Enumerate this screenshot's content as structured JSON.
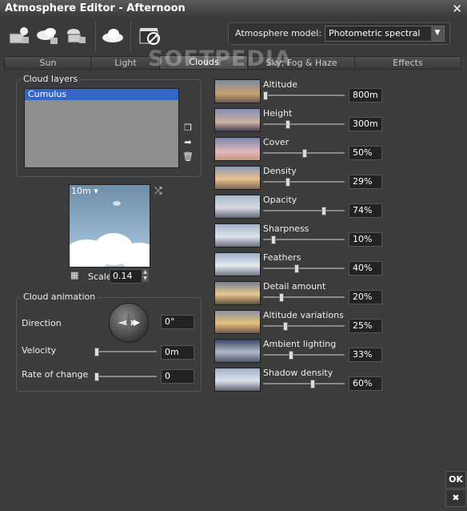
{
  "window": {
    "title": "Atmosphere Editor - Afternoon"
  },
  "toolbar": {
    "model_label": "Atmosphere model:",
    "model_value": "Photometric spectral",
    "buttons": [
      "sun-preset-icon",
      "sky-preset-icon",
      "haze-preset-icon",
      "cloud-icon",
      "animation-icon"
    ]
  },
  "watermark": "SOFTPEDIA",
  "tabs": [
    {
      "label": "Sun",
      "active": false
    },
    {
      "label": "Light",
      "active": false
    },
    {
      "label": "Clouds",
      "active": true
    },
    {
      "label": "Sky, Fog & Haze",
      "active": false
    },
    {
      "label": "Effects",
      "active": false
    }
  ],
  "cloud_layers": {
    "title": "Cloud layers",
    "items": [
      "Cumulus"
    ]
  },
  "preview": {
    "size": "10m",
    "scale_label": "Scale",
    "scale_value": "0.14"
  },
  "animation": {
    "title": "Cloud animation",
    "direction_label": "Direction",
    "direction_value": "0°",
    "velocity_label": "Velocity",
    "velocity_value": "0m",
    "velocity_level": 0,
    "rate_label": "Rate of change",
    "rate_value": "0",
    "rate_level": 0
  },
  "properties": [
    {
      "label": "Altitude",
      "value": "800m",
      "level": 0.0
    },
    {
      "label": "Height",
      "value": "300m",
      "level": 0.29
    },
    {
      "label": "Cover",
      "value": "50%",
      "level": 0.5
    },
    {
      "label": "Density",
      "value": "29%",
      "level": 0.29
    },
    {
      "label": "Opacity",
      "value": "74%",
      "level": 0.74
    },
    {
      "label": "Sharpness",
      "value": "10%",
      "level": 0.1
    },
    {
      "label": "Feathers",
      "value": "40%",
      "level": 0.4
    },
    {
      "label": "Detail amount",
      "value": "20%",
      "level": 0.2
    },
    {
      "label": "Altitude variations",
      "value": "25%",
      "level": 0.25
    },
    {
      "label": "Ambient lighting",
      "value": "33%",
      "level": 0.33
    },
    {
      "label": "Shadow density",
      "value": "60%",
      "level": 0.6
    }
  ],
  "buttons": {
    "ok": "OK",
    "cancel": "✖"
  }
}
